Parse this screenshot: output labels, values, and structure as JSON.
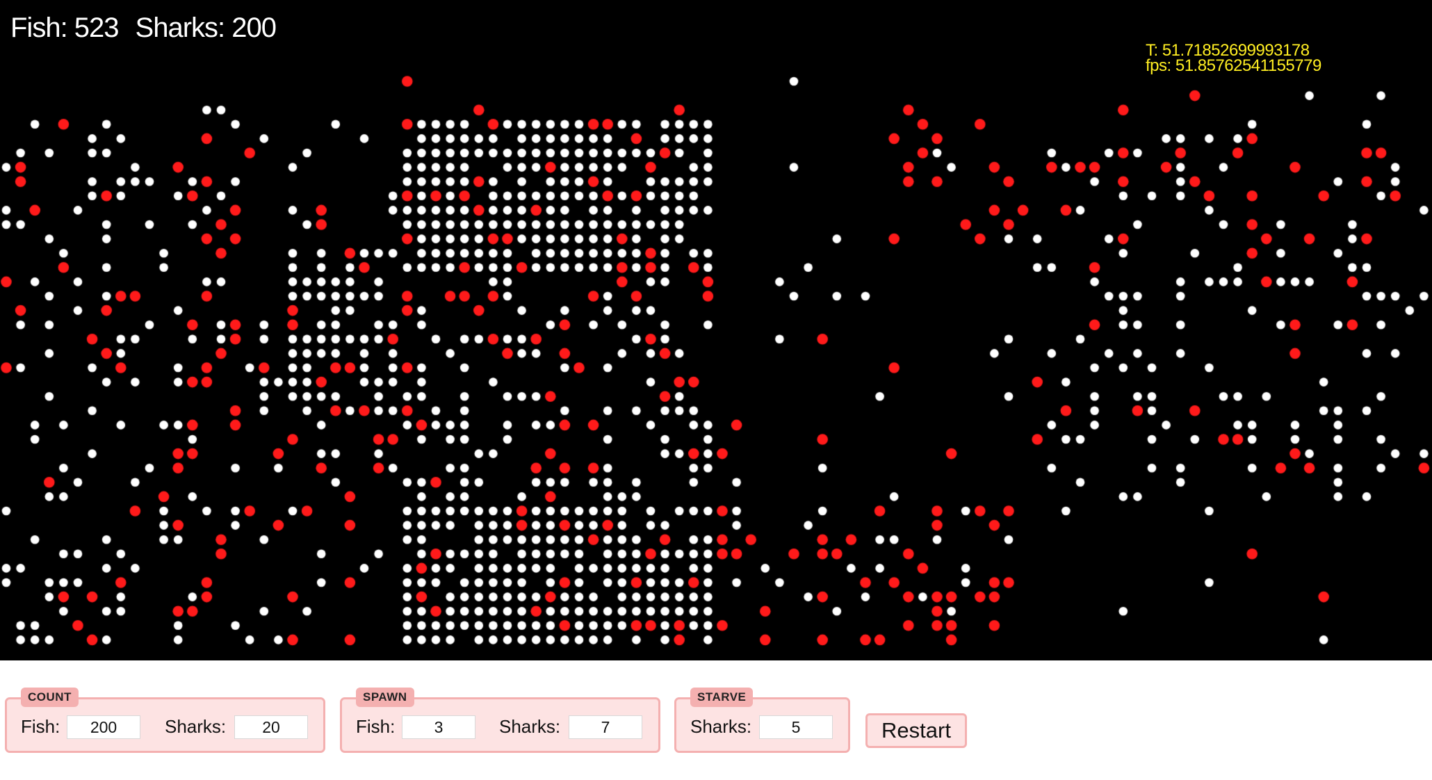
{
  "hud": {
    "fish_label": "Fish: 523",
    "sharks_label": "Sharks: 200"
  },
  "stats": {
    "t_line": "T: 51.71852699993178",
    "fps_line": "fps: 51.85762541155779"
  },
  "colors": {
    "background": "#000000",
    "fish": "#ffffff",
    "shark": "#ff1a1a",
    "stats": "#ffee22",
    "panel_border": "#f4b0b0",
    "panel_bg": "#fde3e3"
  },
  "controls": {
    "count": {
      "legend": "COUNT",
      "fish_label": "Fish:",
      "fish_value": "200",
      "sharks_label": "Sharks:",
      "sharks_value": "20"
    },
    "spawn": {
      "legend": "SPAWN",
      "fish_label": "Fish:",
      "fish_value": "3",
      "sharks_label": "Sharks:",
      "sharks_value": "7"
    },
    "starve": {
      "legend": "STARVE",
      "sharks_label": "Sharks:",
      "sharks_value": "5"
    },
    "restart_label": "Restart"
  },
  "grid": {
    "cols": 100,
    "rows": 41,
    "fish_count": 523,
    "shark_count": 200,
    "regions": [
      {
        "c0": 0,
        "c1": 12,
        "r0": 3,
        "r1": 40,
        "fish": 0.18,
        "shark": 0.05
      },
      {
        "c0": 12,
        "c1": 28,
        "r0": 3,
        "r1": 40,
        "fish": 0.12,
        "shark": 0.1
      },
      {
        "c0": 20,
        "c1": 31,
        "r0": 12,
        "r1": 24,
        "fish": 0.55,
        "shark": 0.15
      },
      {
        "c0": 28,
        "c1": 50,
        "r0": 3,
        "r1": 14,
        "fish": 0.82,
        "shark": 0.08
      },
      {
        "c0": 28,
        "c1": 50,
        "r0": 14,
        "r1": 30,
        "fish": 0.3,
        "shark": 0.12
      },
      {
        "c0": 28,
        "c1": 50,
        "r0": 30,
        "r1": 40,
        "fish": 0.78,
        "shark": 0.08
      },
      {
        "c0": 50,
        "c1": 60,
        "r0": 30,
        "r1": 40,
        "fish": 0.06,
        "shark": 0.1
      },
      {
        "c0": 60,
        "c1": 72,
        "r0": 3,
        "r1": 12,
        "fish": 0.05,
        "shark": 0.14
      },
      {
        "c0": 60,
        "c1": 72,
        "r0": 30,
        "r1": 40,
        "fish": 0.08,
        "shark": 0.2
      },
      {
        "c0": 72,
        "c1": 100,
        "r0": 3,
        "r1": 30,
        "fish": 0.16,
        "shark": 0.04
      }
    ]
  }
}
